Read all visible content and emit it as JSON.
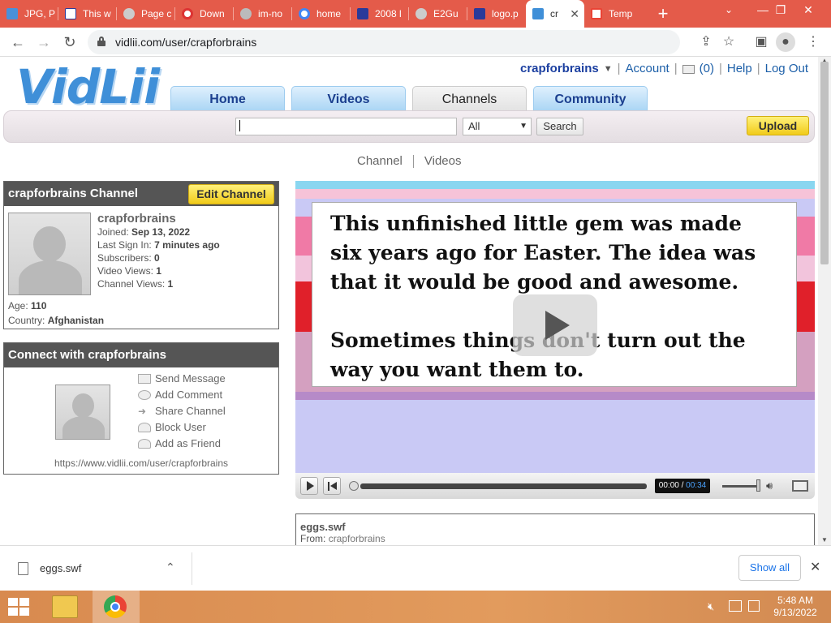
{
  "browser": {
    "tabs": [
      {
        "title": "JPG, P",
        "color": "#4a90d9"
      },
      {
        "title": "This w",
        "color": "#ffffff"
      },
      {
        "title": "Page c",
        "color": "#cccccc"
      },
      {
        "title": "Down",
        "color": "#d33"
      },
      {
        "title": "im-no",
        "color": "#bbbbbb"
      },
      {
        "title": "home",
        "color": "#4285f4"
      },
      {
        "title": "2008 l",
        "color": "#2a3a9a"
      },
      {
        "title": "E2Gu",
        "color": "#cccccc"
      },
      {
        "title": "logo.p",
        "color": "#2a3a9a"
      },
      {
        "title": "cr",
        "color": "#3f8fd8",
        "active": true
      },
      {
        "title": "Temp",
        "color": "#ea4335"
      }
    ],
    "url": "vidlii.com/user/crapforbrains"
  },
  "site": {
    "logo": "VidLii",
    "username": "crapforbrains",
    "account": "Account",
    "inbox_count": "(0)",
    "help": "Help",
    "logout": "Log Out",
    "nav": [
      "Home",
      "Videos",
      "Channels",
      "Community"
    ],
    "nav_selected": "Channels",
    "search": {
      "value": "",
      "category": "All",
      "button": "Search"
    },
    "upload": "Upload",
    "subnav": {
      "channel": "Channel",
      "videos": "Videos"
    }
  },
  "profile": {
    "header": "crapforbrains Channel",
    "edit_button": "Edit Channel",
    "name": "crapforbrains",
    "joined_label": "Joined:",
    "joined": "Sep 13, 2022",
    "last_sign_in_label": "Last Sign In:",
    "last_sign_in": "7 minutes ago",
    "subscribers_label": "Subscribers:",
    "subscribers": "0",
    "video_views_label": "Video Views:",
    "video_views": "1",
    "channel_views_label": "Channel Views:",
    "channel_views": "1",
    "age_label": "Age:",
    "age": "110",
    "country_label": "Country:",
    "country": "Afghanistan"
  },
  "connect": {
    "header": "Connect with crapforbrains",
    "actions": [
      "Send Message",
      "Add Comment",
      "Share Channel",
      "Block User",
      "Add as Friend"
    ],
    "url": "https://www.vidlii.com/user/crapforbrains"
  },
  "video": {
    "slide_line1": "This unfinished little gem was made",
    "slide_line2": "six years ago for Easter. The idea was",
    "slide_line3": "that it would be good and awesome.",
    "slide_line4": "Sometimes things don't turn out the",
    "slide_line5": "way you want them to.",
    "current_time": "00:00",
    "separator": "/",
    "total_time": "00:34",
    "volume": 0.95,
    "filename": "eggs.swf",
    "from_label": "From:",
    "from_user": "crapforbrains"
  },
  "downloads": {
    "file": "eggs.swf",
    "show_all": "Show all"
  },
  "taskbar": {
    "time": "5:48 AM",
    "date": "9/13/2022"
  }
}
